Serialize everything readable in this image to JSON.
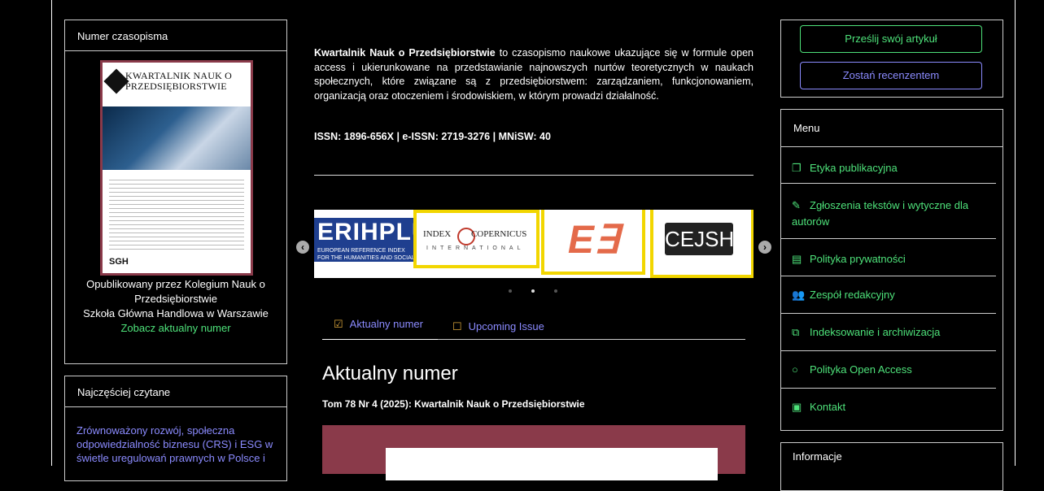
{
  "left": {
    "issue_box_title": "Numer czasopisma",
    "cover": {
      "title": "KWARTALNIK NAUK O PRZEDSIĘBIORSTWIE",
      "publisher_mark": "SGH"
    },
    "published_by": [
      "Opublikowany przez Kolegium Nauk o",
      "Przedsiębiorstwie",
      "Szkoła Główna Handlowa w Warszawie"
    ],
    "current_issue_link": "Zobacz aktualny numer",
    "most_read_title": "Najczęściej czytane",
    "most_read_lines": [
      "Zrównoważony rozwój, społeczna",
      "odpowiedzialność biznesu (CRS) i ESG w",
      "świetle uregulowań prawnych w Polsce i"
    ]
  },
  "main": {
    "intro_bold": "Kwartalnik Nauk o Przedsiębiorstwie",
    "intro_rest": " to czasopismo naukowe ukazujące się w formule open access i ukierunkowane na przedstawianie najnowszych nurtów teoretycznych w naukach społecznych, które związane są z przedsiębiorstwem: zarządzaniem, funkcjonowaniem, organizacją oraz otoczeniem i środowiskiem, w którym prowadzi działalność.",
    "issn": "ISSN: 1896-656X | e-ISSN: 2719-3276 | MNiSW: 40",
    "carousel": {
      "logo1": "ERIHPLUS",
      "logo1_sub": "EUROPEAN REFERENCE INDEX FOR THE HUMANITIES AND SOCIAL SCIENCES",
      "logo2": "INDEX COPERNICUS",
      "logo2_sub": "INTERNATIONAL",
      "logo3": "E∃",
      "logo4": "CEJSH",
      "prev": "‹",
      "next": "›"
    },
    "tabs": [
      "Aktualny numer",
      "Upcoming Issue"
    ],
    "heading": "Aktualny numer",
    "issue_subtitle": "Tom 78 Nr 4 (2025): Kwartalnik Nauk o Przedsiębiorstwie"
  },
  "right": {
    "submit_button": "Prześlij swój artykuł",
    "reviewer_button": "Zostań recenzentem",
    "menu_title": "Menu",
    "menu_items": [
      {
        "label": "Etyka publikacyjna",
        "icon": "copy-icon"
      },
      {
        "label": "Zgłoszenia tekstów i wytyczne dla autorów",
        "icon": "edit-icon"
      },
      {
        "label": "Polityka prywatności",
        "icon": "document-icon"
      },
      {
        "label": "Zespół redakcyjny",
        "icon": "users-icon"
      },
      {
        "label": "Indeksowanie i archiwizacja",
        "icon": "sitemap-icon"
      },
      {
        "label": "Polityka Open Access",
        "icon": "circle-icon"
      },
      {
        "label": "Kontakt",
        "icon": "contact-icon"
      }
    ],
    "info_title": "Informacje"
  },
  "colors": {
    "accent_green": "#4ee27a",
    "accent_purple": "#8b8bff",
    "cover_maroon": "#8a3a4a",
    "highlight_yellow": "#f2d600"
  }
}
